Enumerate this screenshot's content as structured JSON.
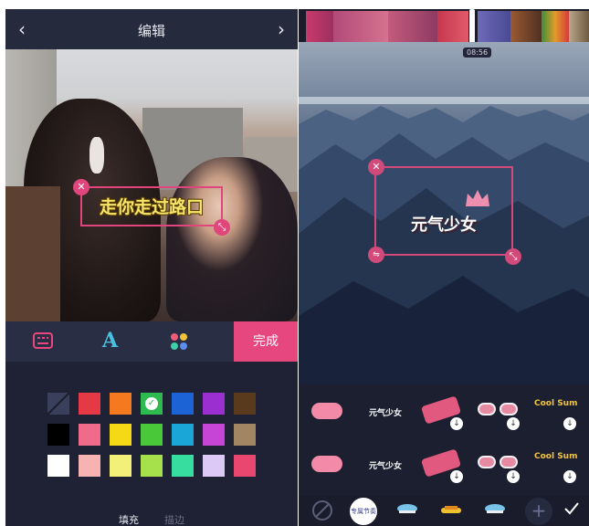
{
  "left_panel": {
    "header": {
      "back_icon": "chevron-left-icon",
      "title": "编辑",
      "forward_icon": "chevron-right-icon"
    },
    "sticker": {
      "text": "走你走过路口",
      "close_icon": "close-icon",
      "resize_icon": "resize-icon",
      "accent": "#e0457b"
    },
    "toolbar": {
      "keyboard_icon": "keyboard-icon",
      "font_icon": "font-icon",
      "font_glyph": "A",
      "color_icon": "palette-icon",
      "done_label": "完成"
    },
    "palette": {
      "rows": [
        [
          "none",
          "#e53946",
          "#f57a1f",
          "#2dba4e",
          "#1c63d6",
          "#9b2fd0",
          "#5a3a1c"
        ],
        [
          "#000000",
          "#f06a8a",
          "#f6d916",
          "#49c93a",
          "#1aa7d8",
          "#c644d6",
          "#a28562"
        ],
        [
          "#ffffff",
          "#f6b3b2",
          "#f3f07a",
          "#a6e04b",
          "#37dc9f",
          "#dcc9f6",
          "#e9476f"
        ]
      ],
      "selected": "#2dba4e"
    },
    "tabs": {
      "fill": "填充",
      "stroke": "描边"
    }
  },
  "right_panel": {
    "timecode": "08:56",
    "sticker": {
      "text": "元气少女",
      "close_icon": "close-icon",
      "flip_icon": "flip-icon",
      "resize_icon": "resize-icon"
    },
    "sticker_grid": {
      "row1": [
        "pink-blush",
        "元气少女",
        "tag",
        "sunglasses",
        "Cool Sum"
      ],
      "row2": [
        "pink-blush",
        "元气少女",
        "tag",
        "sunglasses",
        "Cool Sum"
      ]
    },
    "bottombar": {
      "none_icon": "none-icon",
      "thumb_label": "专属节奏",
      "cloud_icon": "cloud-icon",
      "hat_icon": "hat-icon",
      "add_icon": "plus-icon",
      "confirm_icon": "check-icon"
    }
  }
}
